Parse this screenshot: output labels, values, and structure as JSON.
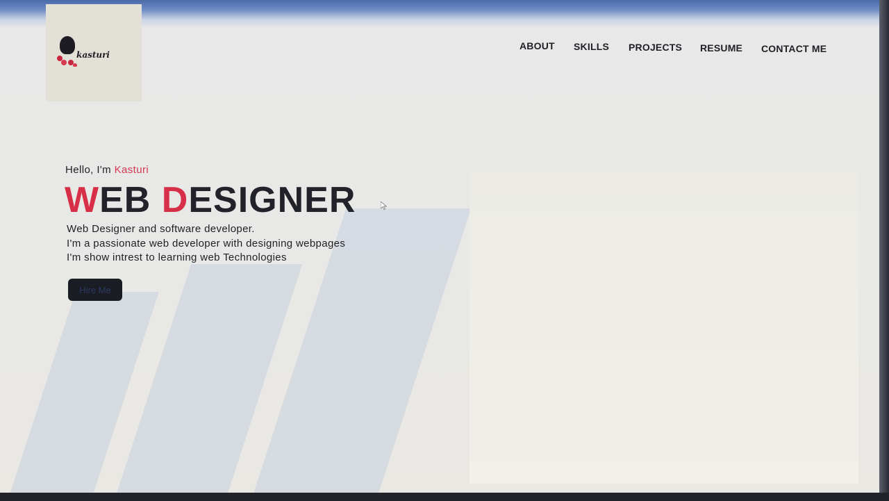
{
  "logo": {
    "text": "kasturi"
  },
  "nav": {
    "items": [
      {
        "label": "ABOUT"
      },
      {
        "label": "SKILLS"
      },
      {
        "label": "PROJECTS"
      },
      {
        "label": "RESUME"
      },
      {
        "label": "CONTACT ME"
      }
    ]
  },
  "hero": {
    "greeting": "Hello, I'm ",
    "name": "Kasturi",
    "headline": {
      "w_accent": "W",
      "w_rest": "EB ",
      "d_accent": "D",
      "d_rest": "ESIGNER"
    },
    "description": [
      "Web Designer and software developer.",
      "I'm a passionate web developer with designing webpages",
      "I'm show intrest to learning web Technologies"
    ],
    "button_label": "Hire Me"
  },
  "colors": {
    "accent": "#d82f48",
    "text_dark": "#22232a",
    "button_bg": "#1b1d24"
  },
  "icons": {
    "logo": "woman-silhouette-icon",
    "cursor": "mouse-pointer-icon"
  }
}
